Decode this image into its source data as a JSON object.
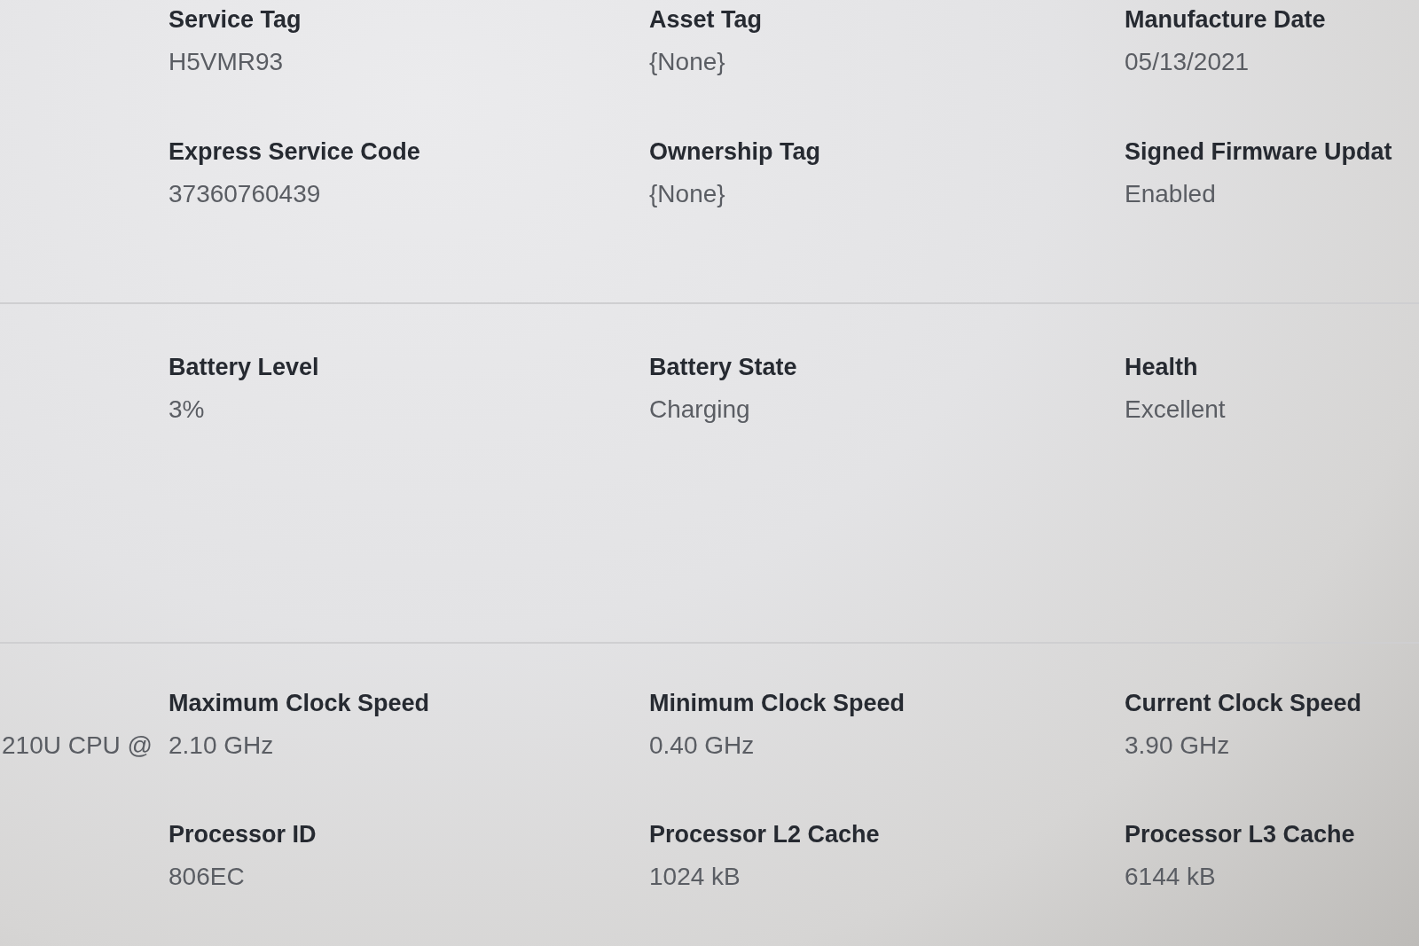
{
  "sections": [
    {
      "fields": [
        {
          "label": "Service Tag",
          "value": "H5VMR93"
        },
        {
          "label": "Asset Tag",
          "value": "{None}"
        },
        {
          "label": "Manufacture Date",
          "value": "05/13/2021"
        },
        {
          "label": "Express Service Code",
          "value": "37360760439"
        },
        {
          "label": "Ownership Tag",
          "value": "{None}"
        },
        {
          "label": "Signed Firmware Updat",
          "value": "Enabled"
        }
      ]
    },
    {
      "fields": [
        {
          "label": "Battery Level",
          "value": "3%"
        },
        {
          "label": "Battery State",
          "value": "Charging"
        },
        {
          "label": "Health",
          "value": "Excellent"
        }
      ]
    },
    {
      "leading_value": "210U CPU @",
      "fields": [
        {
          "label": "Maximum Clock Speed",
          "value": "2.10 GHz"
        },
        {
          "label": "Minimum Clock Speed",
          "value": "0.40 GHz"
        },
        {
          "label": "Current Clock Speed",
          "value": "3.90 GHz"
        },
        {
          "label": "Processor ID",
          "value": "806EC"
        },
        {
          "label": "Processor L2 Cache",
          "value": "1024 kB"
        },
        {
          "label": "Processor L3 Cache",
          "value": "6144 kB"
        }
      ]
    }
  ]
}
